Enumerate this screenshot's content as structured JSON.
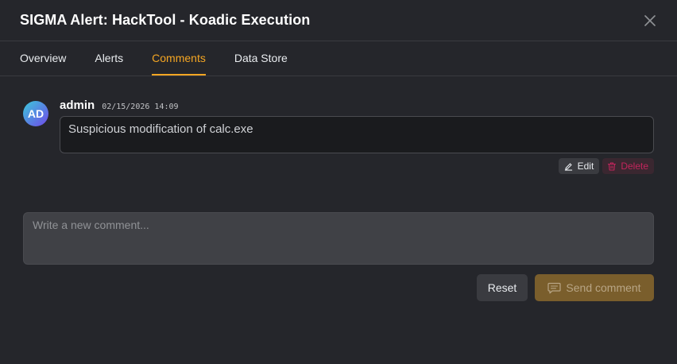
{
  "modal": {
    "title": "SIGMA Alert: HackTool - Koadic Execution",
    "close_icon": "close-icon"
  },
  "tabs": [
    {
      "label": "Overview",
      "active": false
    },
    {
      "label": "Alerts",
      "active": false
    },
    {
      "label": "Comments",
      "active": true
    },
    {
      "label": "Data Store",
      "active": false
    }
  ],
  "comments": [
    {
      "avatar_initials": "AD",
      "author": "admin",
      "timestamp": "02/15/2026 14:09",
      "text": "Suspicious modification of calc.exe",
      "edit_label": "Edit",
      "delete_label": "Delete"
    }
  ],
  "new_comment": {
    "placeholder": "Write a new comment...",
    "value": ""
  },
  "form_actions": {
    "reset_label": "Reset",
    "send_label": "Send comment"
  },
  "colors": {
    "background": "#25262b",
    "accent": "#f5a623",
    "danger": "#c2255c",
    "send_button": "#7a5e2c"
  }
}
